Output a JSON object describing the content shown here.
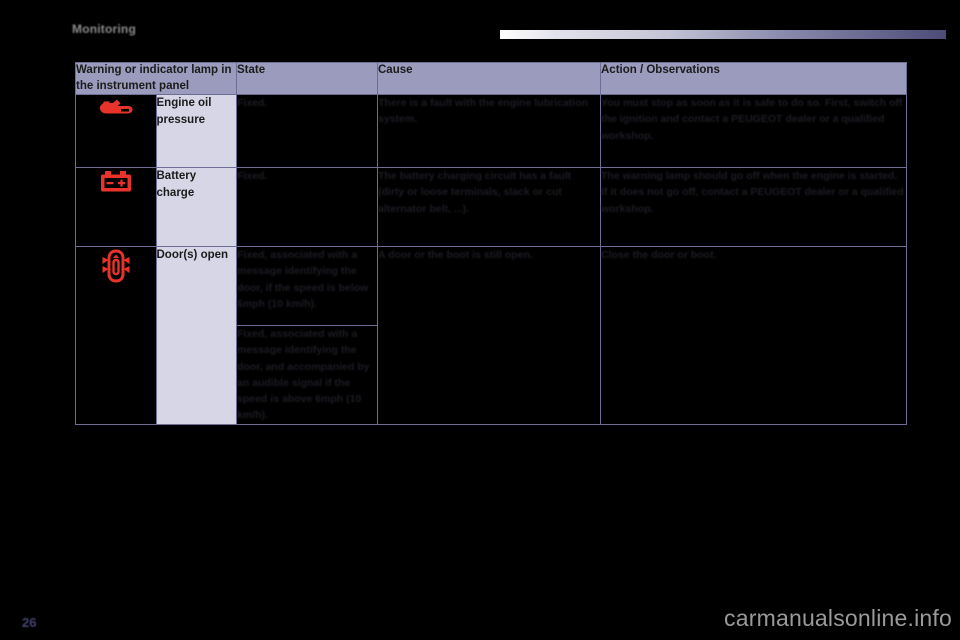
{
  "header": {
    "chapter_title": "Monitoring",
    "rule_gradient_from": "#ffffff",
    "rule_gradient_to": "#4c4c77"
  },
  "table": {
    "columns": [
      "Warning or indicator lamp in the instrument panel",
      "State",
      "Cause",
      "Action / Observations"
    ],
    "header_bg": "#9b9bbd",
    "border_color": "#6d6d96",
    "name_cell_bg": "#d6d6e6",
    "icon_color": "#e8332a",
    "rows": [
      {
        "icon": "engine-oil-pressure-icon",
        "name": "Engine oil pressure",
        "states": [
          "Fixed."
        ],
        "cause": "There is a fault with the engine lubrication system.",
        "action": "You must stop as soon as it is safe to do so. First, switch off the ignition and contact a PEUGEOT dealer or a qualified workshop."
      },
      {
        "icon": "battery-charge-icon",
        "name": "Battery charge",
        "states": [
          "Fixed."
        ],
        "cause": "The battery charging circuit has a fault (dirty or loose terminals, slack or cut alternator belt, ...).",
        "action": "The warning lamp should go off when the engine is started. If it does not go off, contact a PEUGEOT dealer or a qualified workshop."
      },
      {
        "icon": "doors-open-icon",
        "name": "Door(s) open",
        "states": [
          "Fixed, associated with a message identifying the door, if the speed is below 6mph (10 km/h).",
          "Fixed, associated with a message identifying the door, and accompanied by an audible signal if the speed is above 6mph (10 km/h)."
        ],
        "cause": "A door or the boot is still open.",
        "action": "Close the door or boot."
      }
    ]
  },
  "footer": {
    "page_number": "26",
    "watermark": "carmanualsonline.info"
  }
}
